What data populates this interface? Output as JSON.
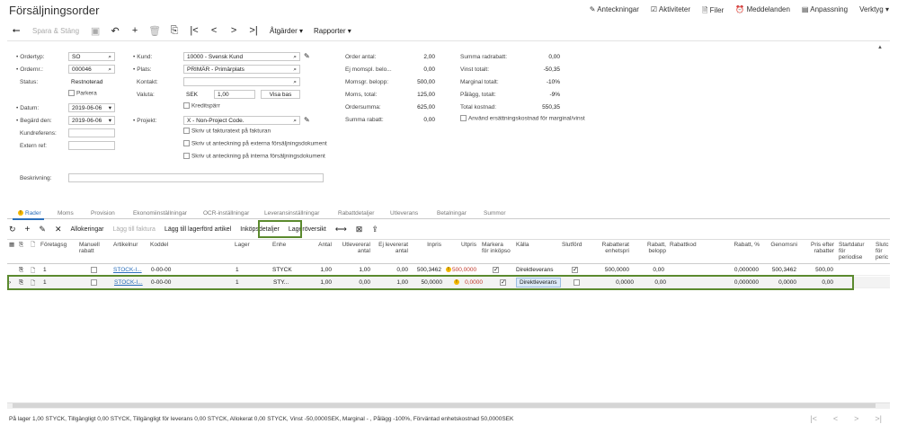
{
  "page": {
    "title": "Försäljningsorder"
  },
  "top_links": [
    {
      "label": "Anteckningar",
      "icon": "note-icon"
    },
    {
      "label": "Aktiviteter",
      "icon": "activities-icon"
    },
    {
      "label": "Filer",
      "icon": "files-icon"
    },
    {
      "label": "Meddelanden",
      "icon": "alarm-icon"
    },
    {
      "label": "Anpassning",
      "icon": "customize-icon"
    },
    {
      "label": "Verktyg ▾",
      "icon": ""
    }
  ],
  "toolbar": {
    "back": "⭠",
    "save_close": "Spara & Stäng",
    "actions": "Åtgärder ▾",
    "reports": "Rapporter ▾"
  },
  "form": {
    "ordertyp_label": "Ordertyp:",
    "ordertyp": "SO",
    "ordernr_label": "Ordernr.:",
    "ordernr": "000046",
    "status_label": "Status:",
    "status": "Restnoterad",
    "parkera_label": "Parkera",
    "datum_label": "Datum:",
    "datum": "2019-06-06",
    "begard_label": "Begärd den:",
    "begard": "2019-06-06",
    "kundref_label": "Kundreferens:",
    "externref_label": "Extern ref:",
    "beskrivning_label": "Beskrivning:",
    "kund_label": "Kund:",
    "kund": "10000 - Svensk Kund",
    "plats_label": "Plats:",
    "plats": "PRIMÄR - Primärplats",
    "kontakt_label": "Kontakt:",
    "valuta_label": "Valuta:",
    "valuta": "SEK",
    "kurs": "1,00",
    "visa_bas": "Visa bas",
    "kreditsparr_label": "Kreditspärr",
    "projekt_label": "Projekt:",
    "projekt": "X - Non-Project Code.",
    "opt1": "Skriv ut fakturatext på fakturan",
    "opt2": "Skriv ut anteckning på externa försäljningsdokument",
    "opt3": "Skriv ut anteckning på interna försäljningsdokument",
    "order_antal_label": "Order antal:",
    "order_antal": "2,00",
    "ej_momspl_label": "Ej momspl. belo...",
    "ej_momspl": "0,00",
    "momsgr_label": "Momsgr. belopp:",
    "momsgr": "500,00",
    "moms_total_label": "Moms, total:",
    "moms_total": "125,00",
    "ordersumma_label": "Ordersumma:",
    "ordersumma": "625,00",
    "summa_rabatt_label": "Summa rabatt:",
    "summa_rabatt": "0,00",
    "summa_radrabatt_label": "Summa radrabatt:",
    "summa_radrabatt": "0,00",
    "vinst_label": "Vinst totalt:",
    "vinst": "-50,35",
    "marginal_label": "Marginal totalt:",
    "marginal": "-10%",
    "palagg_label": "Pålägg, totalt:",
    "palagg": "-9%",
    "total_kostnad_label": "Total kostnad:",
    "total_kostnad": "550,35",
    "ersattning_label": "Använd ersättningskostnad för marginal/vinst"
  },
  "tabs": [
    "Rader",
    "Moms",
    "Provision",
    "Ekonomiinställningar",
    "OCR-inställningar",
    "Leveransinställningar",
    "Rabattdetaljer",
    "Utleverans",
    "Betalningar",
    "Summor"
  ],
  "grid_toolbar": {
    "allokeringar": "Allokeringar",
    "lagg_till_faktura": "Lägg till faktura",
    "lagg_till_lagerford": "Lägg till lagerförd artikel",
    "inkopsdetaljer": "Inköpsdetaljer",
    "lageroversikt": "Lageröversikt"
  },
  "columns": {
    "foretagsg": "Företagsg",
    "manuell_rabatt": "Manuell rabatt",
    "artikelnr": "Artikelnur",
    "koddel": "Koddel",
    "lager": "Lager",
    "enhet": "Enhe",
    "antal": "Antal",
    "utlevererat": "Utlevereral antal",
    "ej_levererat": "Ej levererat antal",
    "inpris": "Inpris",
    "utpris": "Utpris",
    "markera": "Markera för inköpso",
    "kalla": "Källa",
    "slutford": "Slutförd",
    "rabatterat": "Rabatterat enhetspri",
    "rabatt_belopp": "Rabatt, belopp",
    "rabattkod": "Rabattkod",
    "rabatt_pct": "Rabatt, %",
    "genomsn": "Genomsni",
    "pris_efter": "Pris efter rabatter",
    "startdatum": "Startdatur för periodise",
    "slut": "Slutc för peric"
  },
  "rows": [
    {
      "foretagsg": "1",
      "artikelnr": "STOCK-I...",
      "koddel": "0-00-00",
      "lager": "1",
      "enhet": "STYCK",
      "antal": "1,00",
      "utlevererat": "1,00",
      "ej_levererat": "0,00",
      "inpris": "500,3462",
      "utpris": "500,0000",
      "kalla": "Direktleverans",
      "rabatterat": "500,0000",
      "rabatt_belopp": "0,00",
      "rabatt_pct": "0,000000",
      "genomsn": "500,3462",
      "pris_efter": "500,00"
    },
    {
      "foretagsg": "1",
      "artikelnr": "STOCK-I...",
      "koddel": "0-00-00",
      "lager": "1",
      "enhet": "STY...",
      "antal": "1,00",
      "utlevererat": "0,00",
      "ej_levererat": "1,00",
      "inpris": "50,0000",
      "utpris": "0,0000",
      "kalla": "Direktleverans",
      "rabatterat": "0,0000",
      "rabatt_belopp": "0,00",
      "rabatt_pct": "0,000000",
      "genomsn": "0,0000",
      "pris_efter": "0,00"
    }
  ],
  "status_bar": "På lager 1,00 STYCK, Tillgängligt 0,00 STYCK, Tillgängligt för leverans 0,00 STYCK, Allokerat 0,00 STYCK, Vinst -50,0000SEK, Marginal - , Pålägg -100%, Förväntad enhetskostnad 50,0000SEK",
  "colors": {
    "accent": "#2a6ebb",
    "highlight": "#5b8a2e",
    "warning": "#f5b800"
  }
}
